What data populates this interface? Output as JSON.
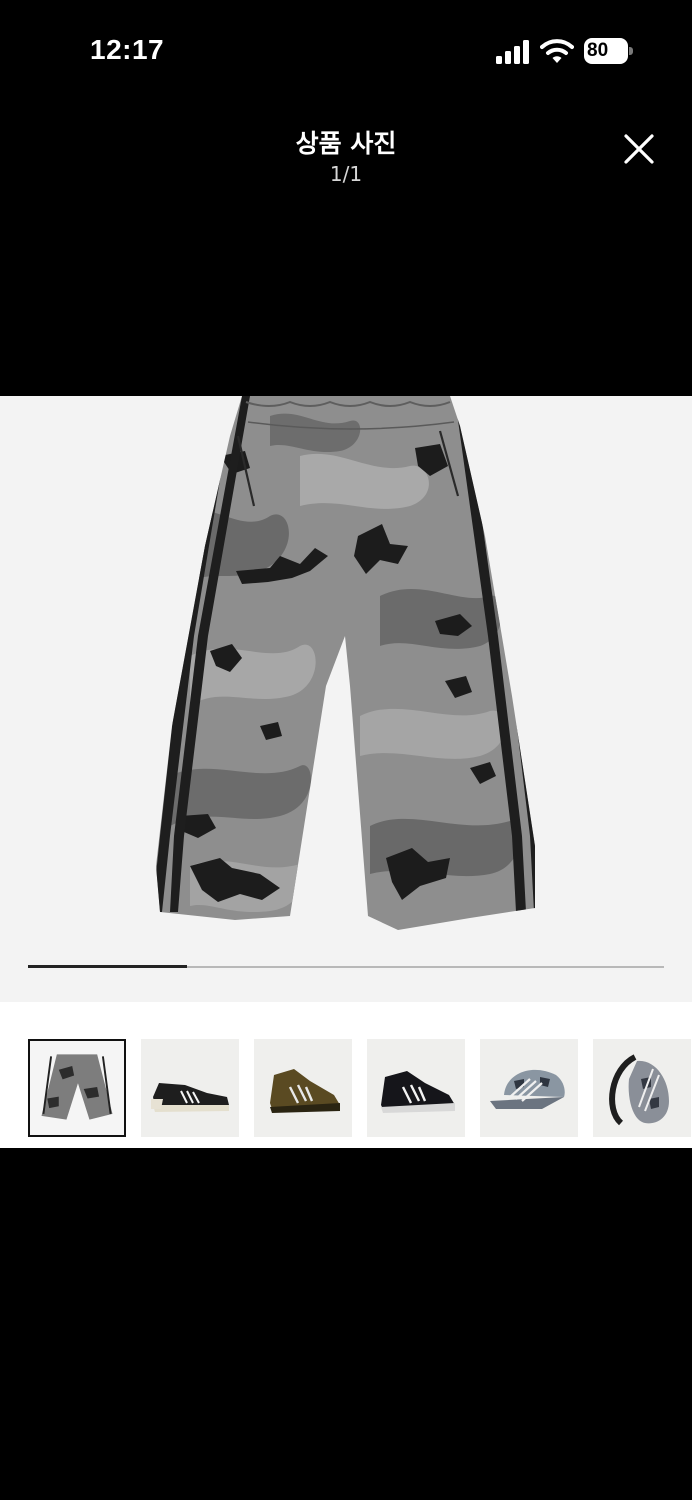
{
  "status_bar": {
    "time": "12:17",
    "battery": "80",
    "icons": [
      "signal-icon",
      "wifi-icon",
      "battery-icon"
    ]
  },
  "viewer": {
    "title": "상품 사진",
    "counter": "1/1",
    "close_icon": "close-icon"
  },
  "slider": {
    "progress": 0.25
  },
  "thumbnails": [
    {
      "name": "camo-pants-thumbnail",
      "selected": true
    },
    {
      "name": "low-top-sneaker-thumbnail",
      "selected": false
    },
    {
      "name": "olive-high-top-sneaker-thumbnail",
      "selected": false
    },
    {
      "name": "black-high-top-sneaker-thumbnail",
      "selected": false
    },
    {
      "name": "camo-cap-thumbnail",
      "selected": false
    },
    {
      "name": "camo-sling-bag-thumbnail",
      "selected": false
    }
  ],
  "colors": {
    "background": "#000000",
    "stage": "#f3f3f3",
    "camo_light": "#8f8f8f",
    "camo_mid": "#6a6a6a",
    "camo_dark": "#1c1c1c"
  }
}
